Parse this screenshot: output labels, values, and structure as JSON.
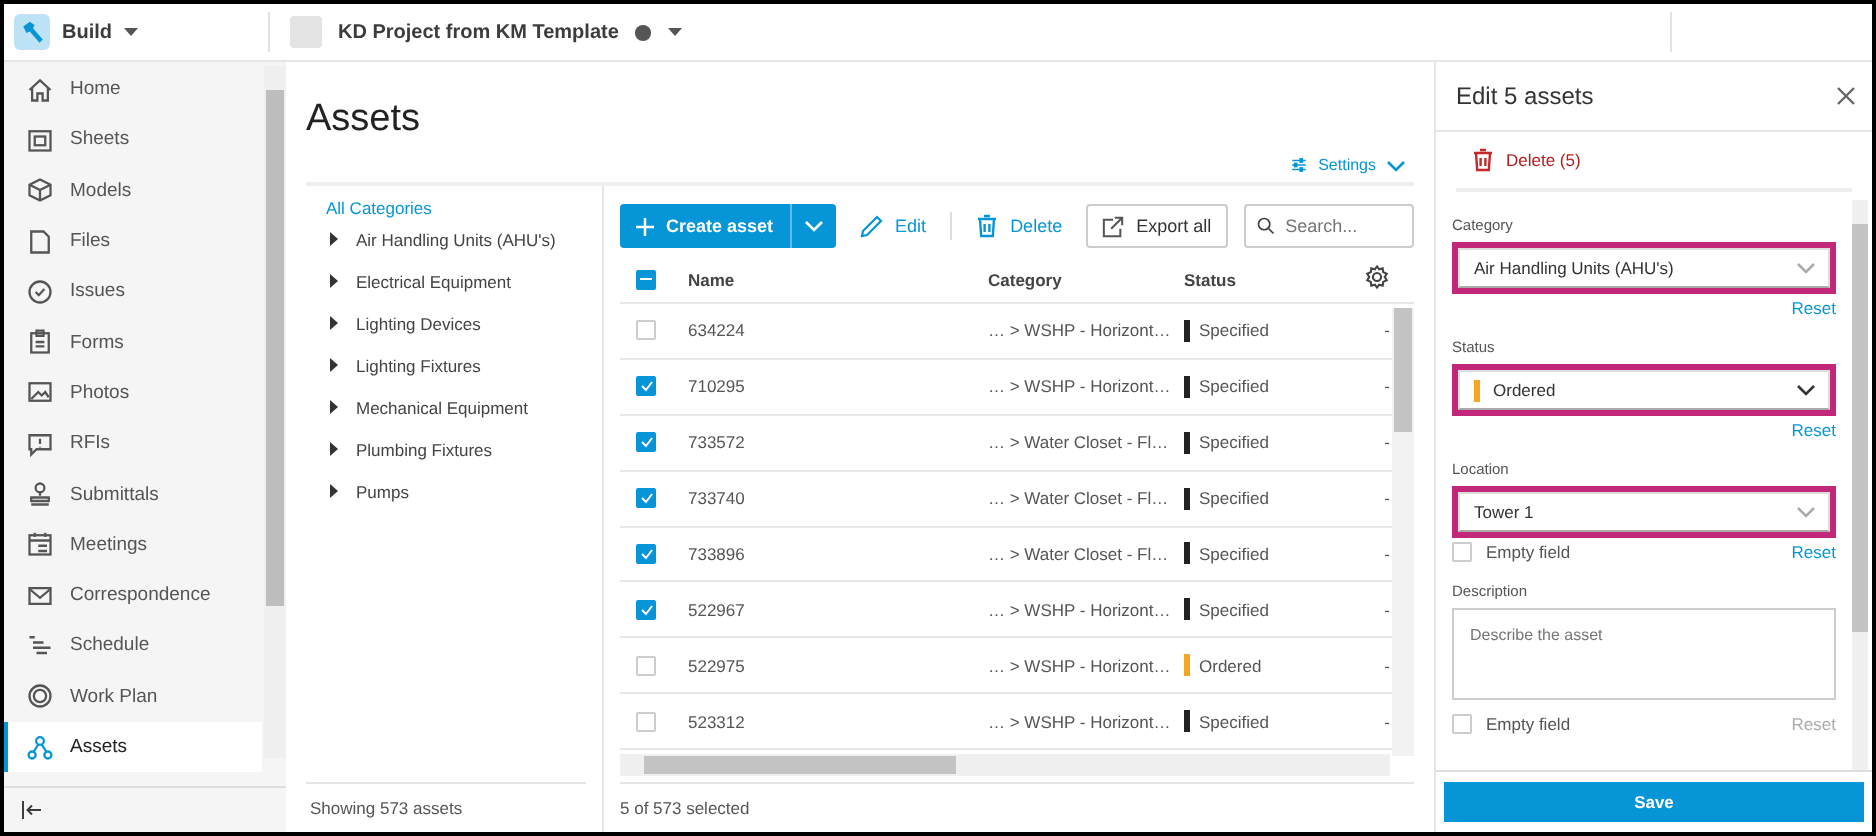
{
  "top_bar": {
    "module": "Build",
    "project": "KD Project from KM Template"
  },
  "nav": {
    "items": [
      {
        "label": "Home",
        "selected": false
      },
      {
        "label": "Sheets",
        "selected": false
      },
      {
        "label": "Models",
        "selected": false
      },
      {
        "label": "Files",
        "selected": false
      },
      {
        "label": "Issues",
        "selected": false
      },
      {
        "label": "Forms",
        "selected": false
      },
      {
        "label": "Photos",
        "selected": false
      },
      {
        "label": "RFIs",
        "selected": false
      },
      {
        "label": "Submittals",
        "selected": false
      },
      {
        "label": "Meetings",
        "selected": false
      },
      {
        "label": "Correspondence",
        "selected": false
      },
      {
        "label": "Schedule",
        "selected": false
      },
      {
        "label": "Work Plan",
        "selected": false
      },
      {
        "label": "Assets",
        "selected": true
      }
    ]
  },
  "page": {
    "title": "Assets",
    "settings": "Settings"
  },
  "categories": {
    "all": "All Categories",
    "items": [
      "Air Handling Units (AHU's)",
      "Electrical Equipment",
      "Lighting Devices",
      "Lighting Fixtures",
      "Mechanical Equipment",
      "Plumbing Fixtures",
      "Pumps"
    ],
    "footer": "Showing 573 assets"
  },
  "toolbar": {
    "create": "Create asset",
    "edit": "Edit",
    "delete": "Delete",
    "export": "Export all",
    "search_placeholder": "Search..."
  },
  "table": {
    "indeterminate": true,
    "columns": [
      "Name",
      "Category",
      "Status"
    ],
    "rows": [
      {
        "checked": false,
        "name": "634224",
        "category": "… > WSHP - Horizont…",
        "status": "Specified",
        "color": "#222222",
        "column_5": "-"
      },
      {
        "checked": true,
        "name": "710295",
        "category": "… > WSHP - Horizont…",
        "status": "Specified",
        "color": "#222222",
        "column_5": "-"
      },
      {
        "checked": true,
        "name": "733572",
        "category": "… > Water Closet - Fl…",
        "status": "Specified",
        "color": "#222222",
        "column_5": "-"
      },
      {
        "checked": true,
        "name": "733740",
        "category": "… > Water Closet - Fl…",
        "status": "Specified",
        "color": "#222222",
        "column_5": "-"
      },
      {
        "checked": true,
        "name": "733896",
        "category": "… > Water Closet - Fl…",
        "status": "Specified",
        "color": "#222222",
        "column_5": "-"
      },
      {
        "checked": true,
        "name": "522967",
        "category": "… > WSHP - Horizont…",
        "status": "Specified",
        "color": "#222222",
        "column_5": "-"
      },
      {
        "checked": false,
        "name": "522975",
        "category": "… > WSHP - Horizont…",
        "status": "Ordered",
        "color": "#f5a623",
        "column_5": "-"
      },
      {
        "checked": false,
        "name": "523312",
        "category": "… > WSHP - Horizont…",
        "status": "Specified",
        "color": "#222222",
        "column_5": "-"
      }
    ],
    "footer": "5 of 573 selected"
  },
  "edit_panel": {
    "title": "Edit 5 assets",
    "delete": "Delete (5)",
    "fields": [
      {
        "kind": "select",
        "label": "Category",
        "value": "Air Handling Units (AHU's)",
        "highlighted": true,
        "reset": "Reset"
      },
      {
        "kind": "status",
        "label": "Status",
        "value": "Ordered",
        "color": "#f5a623",
        "highlighted": true,
        "reset": "Reset"
      },
      {
        "kind": "select",
        "label": "Location",
        "value": "Tower 1",
        "highlighted": true,
        "empty_label": "Empty field",
        "empty_checked": false,
        "reset": "Reset"
      },
      {
        "kind": "textarea",
        "label": "Description",
        "placeholder": "Describe the asset",
        "highlighted": false,
        "empty_label": "Empty field",
        "empty_checked": false,
        "reset": "Reset",
        "reset_disabled": true
      }
    ],
    "save": "Save"
  }
}
